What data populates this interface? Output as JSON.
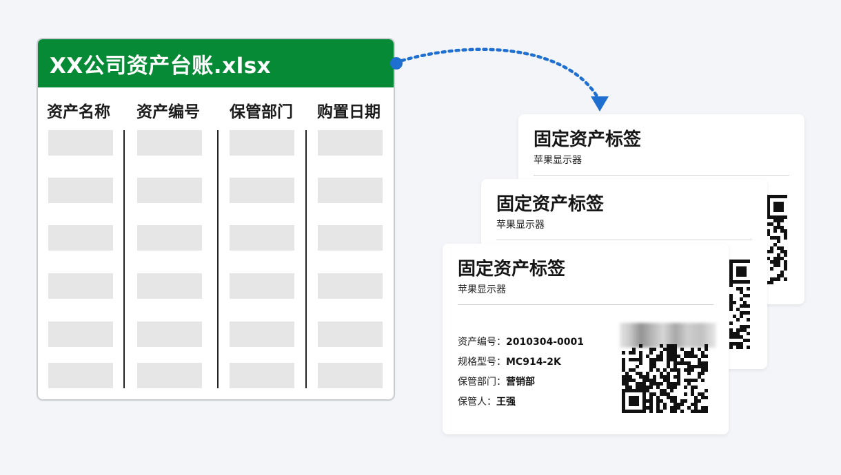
{
  "colors": {
    "sheet_header": "#078a36",
    "connector": "#1f6fd1",
    "page_background": "#f3f5f9"
  },
  "spreadsheet": {
    "title": "XX公司资产台账.xlsx",
    "columns": [
      "资产名称",
      "资产编号",
      "保管部门",
      "购置日期"
    ],
    "placeholder_rows": 6
  },
  "connector": {
    "style": "dotted arrow",
    "icon": "arrow-down-icon"
  },
  "label_cards": [
    {
      "title": "固定资产标签",
      "subtitle": "苹果显示器"
    },
    {
      "title": "固定资产标签",
      "subtitle": "苹果显示器"
    },
    {
      "title": "固定资产标签",
      "subtitle": "苹果显示器",
      "fields": [
        {
          "label": "资产编号：",
          "value": "2010304-0001"
        },
        {
          "label": "规格型号：",
          "value": "MC914-2K"
        },
        {
          "label": "保管部门：",
          "value": "营销部"
        },
        {
          "label": "保管人：",
          "value": "王强"
        }
      ],
      "qr_icon": "qr-code-icon"
    }
  ]
}
